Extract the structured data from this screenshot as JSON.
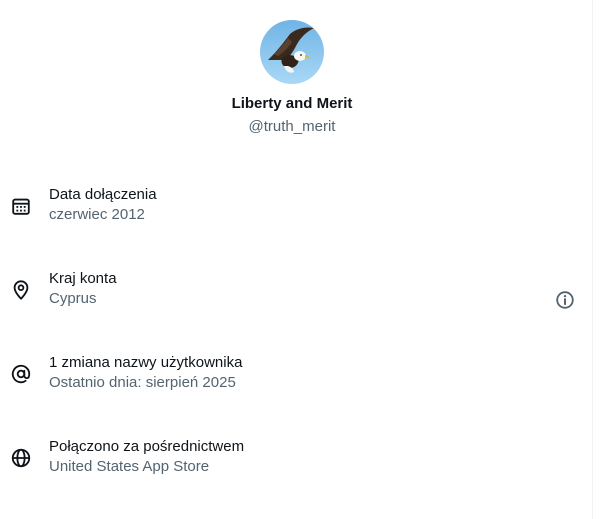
{
  "profile": {
    "display_name": "Liberty and Merit",
    "handle": "@truth_merit",
    "avatar_icon": "bald-eagle-avatar"
  },
  "rows": [
    {
      "icon": "calendar-icon",
      "label": "Data dołączenia",
      "value": "czerwiec 2012"
    },
    {
      "icon": "location-pin-icon",
      "label": "Kraj konta",
      "value": "Cyprus"
    },
    {
      "icon": "at-sign-icon",
      "label": "1 zmiana nazwy użytkownika",
      "value": "Ostatnio dnia: sierpień 2025"
    },
    {
      "icon": "globe-icon",
      "label": "Połączono za pośrednictwem",
      "value": "United States App Store"
    }
  ],
  "info_button_icon": "info-icon",
  "colors": {
    "primary_text": "#0f1419",
    "secondary_text": "#536471",
    "avatar_sky": "#8ec8ef"
  }
}
